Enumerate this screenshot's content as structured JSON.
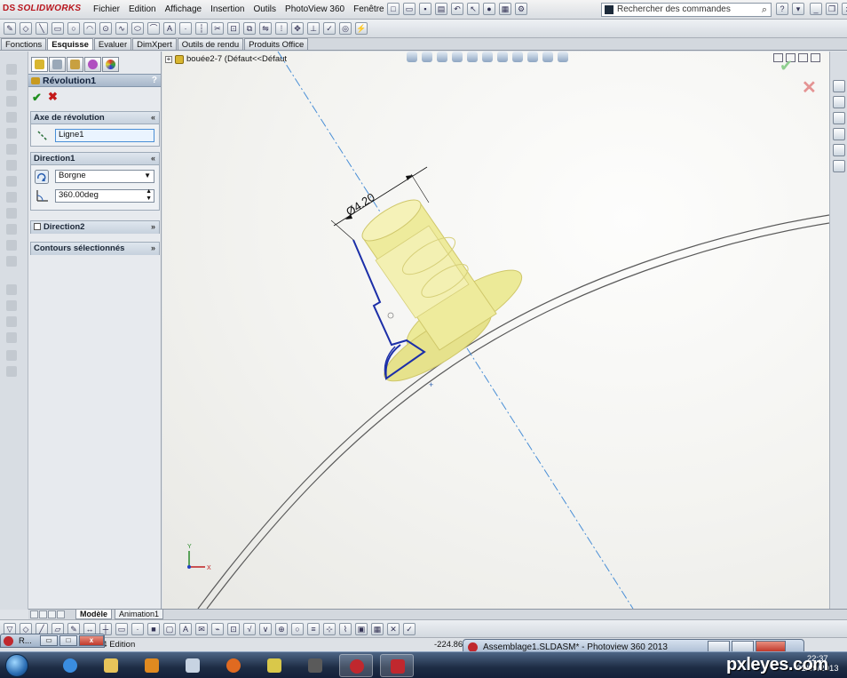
{
  "app": {
    "logo_text": "SOLIDWORKS",
    "logo_prefix": "DS"
  },
  "menu": {
    "items": [
      "Fichier",
      "Edition",
      "Affichage",
      "Insertion",
      "Outils",
      "PhotoView 360",
      "Fenêtre",
      "?"
    ]
  },
  "search": {
    "placeholder": "Rechercher des commandes"
  },
  "tabs": [
    "Fonctions",
    "Esquisse",
    "Evaluer",
    "DimXpert",
    "Outils de rendu",
    "Produits Office"
  ],
  "active_tab": "Esquisse",
  "property_manager": {
    "title": "Révolution1",
    "help": "?",
    "ok_symbol": "✔",
    "cancel_symbol": "✖",
    "axis_group": {
      "label": "Axe de révolution",
      "value": "Ligne1"
    },
    "direction1_group": {
      "label": "Direction1",
      "type_value": "Borgne",
      "angle_value": "360.00deg"
    },
    "direction2_group": {
      "label": "Direction2"
    },
    "contours_group": {
      "label": "Contours sélectionnés"
    }
  },
  "viewport": {
    "tree_label": "bouée2-7  (Défaut<<Défaut",
    "dimension_label": "Ø4.20",
    "axis_x_label": "X",
    "axis_y_label": "Y",
    "colors": {
      "part_fill": "#efec9a",
      "part_edge": "#c8c060",
      "profile": "#1c2fa8",
      "axis_line": "#4a8fd6",
      "sweep_line": "#555555"
    }
  },
  "bottom_tabs": [
    "Modèle",
    "Animation1"
  ],
  "status": {
    "left": "64 Edition",
    "coord": "-224.86m"
  },
  "minimized_window": {
    "label": "R..."
  },
  "photoview_window": {
    "title": "Assemblage1.SLDASM* - Photoview 360 2013"
  },
  "clock": {
    "time": "22:37",
    "date": "01/09/2013"
  },
  "watermark": "pxleyes.com"
}
